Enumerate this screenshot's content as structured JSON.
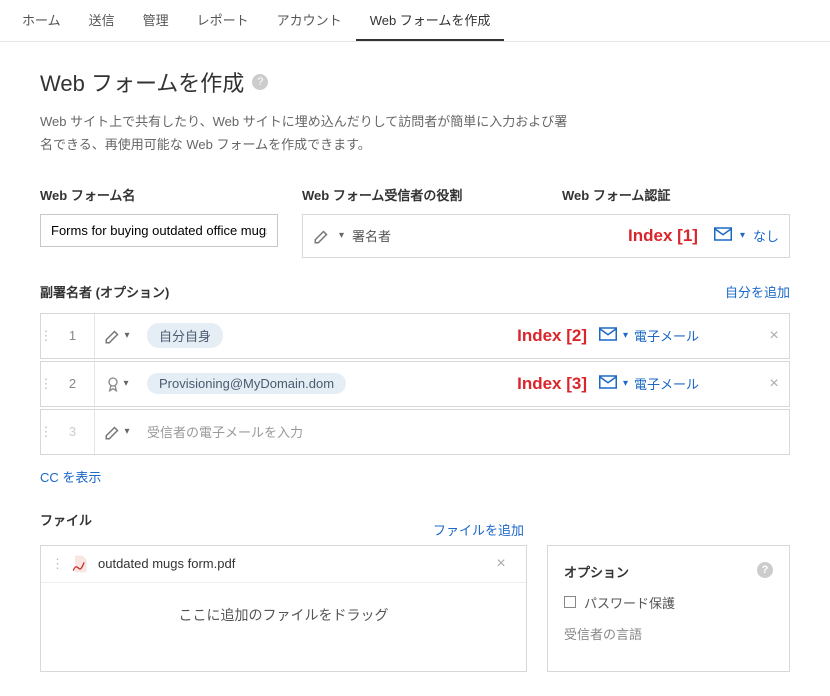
{
  "nav": [
    "ホーム",
    "送信",
    "管理",
    "レポート",
    "アカウント",
    "Web フォームを作成"
  ],
  "nav_active_index": 5,
  "page": {
    "title": "Web フォームを作成",
    "description": "Web サイト上で共有したり、Web サイトに埋め込んだりして訪問者が簡単に入力および署名できる、再使用可能な Web フォームを作成できます。"
  },
  "labels": {
    "form_name": "Web フォーム名",
    "recipient_role": "Web フォーム受信者の役割",
    "auth": "Web フォーム認証",
    "counter_signers": "副署名者 (オプション)",
    "add_self": "自分を追加",
    "show_cc": "CC を表示",
    "file": "ファイル",
    "add_file": "ファイルを追加",
    "options": "オプション",
    "password_protect": "パスワード保護",
    "recipient_language": "受信者の言語"
  },
  "form_name_value": "Forms for buying outdated office mugs",
  "primary_recipient": {
    "role": "署名者",
    "index_label": "Index [1]",
    "auth": "なし"
  },
  "roster": [
    {
      "n": "1",
      "icon": "pen",
      "chip": "自分自身",
      "email": "",
      "index_label": "Index [2]",
      "auth": "電子メール",
      "removable": true
    },
    {
      "n": "2",
      "icon": "seal",
      "chip": "Provisioning@MyDomain.dom",
      "email": "",
      "index_label": "Index [3]",
      "auth": "電子メール",
      "removable": true
    },
    {
      "n": "3",
      "icon": "pen",
      "chip": "",
      "email": "",
      "placeholder": "受信者の電子メールを入力",
      "disabled": true
    }
  ],
  "files": [
    {
      "name": "outdated mugs form.pdf"
    }
  ],
  "file_drop_text": "ここに追加のファイルをドラッグ"
}
